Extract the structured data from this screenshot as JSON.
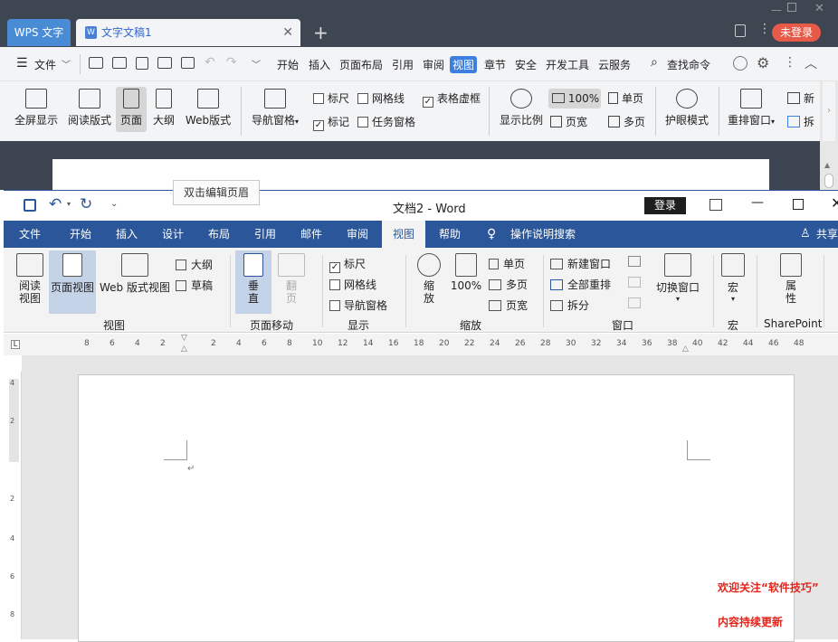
{
  "wps": {
    "app_tab": "WPS 文字",
    "doc_tab": "文字文稿1",
    "login": "未登录",
    "menus": [
      "文件",
      "开始",
      "插入",
      "页面布局",
      "引用",
      "审阅",
      "视图",
      "章节",
      "安全",
      "开发工具",
      "云服务",
      "查找命令"
    ],
    "ribbon": [
      "全屏显示",
      "阅读版式",
      "页面",
      "大纲",
      "Web版式",
      "导航窗格",
      "标尺",
      "网格线",
      "表格虚框",
      "标记",
      "任务窗格",
      "显示比例",
      "100%",
      "单页",
      "页宽",
      "多页",
      "护眼模式",
      "重排窗口",
      "新",
      "拆"
    ],
    "tooltip": "双击编辑页眉"
  },
  "word": {
    "title": "文档2  -  Word",
    "login": "登录",
    "share": "共享",
    "tabs": [
      "文件",
      "开始",
      "插入",
      "设计",
      "布局",
      "引用",
      "邮件",
      "审阅",
      "视图",
      "帮助",
      "操作说明搜索"
    ],
    "ribbon": {
      "read_view": "阅读\n视图",
      "page_view": "页面视图",
      "web_view": "Web 版式视图",
      "outline": "大纲",
      "draft": "草稿",
      "group_view": "视图",
      "vertical": "垂\n直",
      "flip": "翻\n页",
      "group_pagemove": "页面移动",
      "ruler": "标尺",
      "gridlines": "网格线",
      "navpane": "导航窗格",
      "group_show": "显示",
      "zoom": "缩\n放",
      "zoom100": "100%",
      "one_page": "单页",
      "multi_page": "多页",
      "page_width": "页宽",
      "group_zoom": "缩放",
      "new_window": "新建窗口",
      "arrange_all": "全部重排",
      "split": "拆分",
      "switch_window": "切换窗口",
      "group_window": "窗口",
      "macro": "宏",
      "group_macro": "宏",
      "properties": "属\n性",
      "group_sharepoint": "SharePoint"
    },
    "ruler_numbers": [
      "8",
      "6",
      "4",
      "2",
      "",
      "2",
      "4",
      "6",
      "8",
      "10",
      "12",
      "14",
      "16",
      "18",
      "20",
      "22",
      "24",
      "26",
      "28",
      "30",
      "32",
      "34",
      "36",
      "38",
      "40",
      "42",
      "44",
      "46",
      "48"
    ],
    "vruler_numbers": [
      "4",
      "2",
      "2",
      "4",
      "6",
      "8"
    ]
  },
  "notes": {
    "line1": "欢迎关注“软件技巧”",
    "line2": "内容持续更新"
  },
  "colors": {
    "word_blue": "#2b579a",
    "wps_dark": "#3d4552",
    "wps_blue": "#3c7fe0",
    "red_note": "#e3241b"
  }
}
